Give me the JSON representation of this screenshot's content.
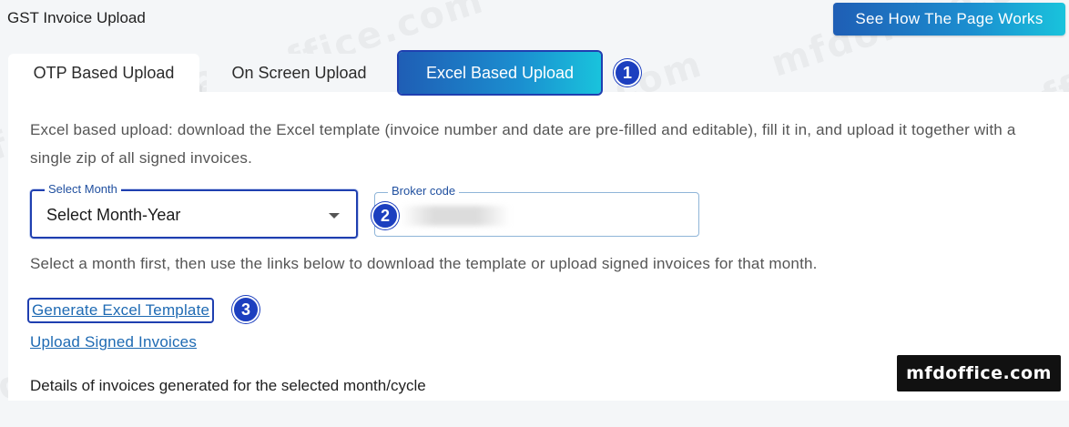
{
  "header": {
    "title": "GST Invoice Upload",
    "help_button": "See How The Page Works"
  },
  "tabs": [
    {
      "label": "OTP Based Upload",
      "active": false
    },
    {
      "label": "On Screen Upload",
      "active": false
    },
    {
      "label": "Excel Based Upload",
      "active": true
    }
  ],
  "callouts": [
    "1",
    "2",
    "3"
  ],
  "description": "Excel based upload: download the Excel template (invoice number and date are pre-filled and editable), fill it in, and upload it together with a single zip of all signed invoices.",
  "form": {
    "month_label": "Select Month",
    "month_value": "Select Month-Year",
    "broker_label": "Broker code",
    "broker_value": ""
  },
  "hint": "Select a month first, then use the links below to download the template or upload signed invoices for that month.",
  "links": {
    "generate": "Generate Excel Template",
    "upload": "Upload Signed Invoices"
  },
  "section_title": "Details of invoices generated for the selected month/cycle",
  "watermark": "mfdoffice.com",
  "colors": {
    "accent_start": "#1f5eb5",
    "accent_end": "#19c3dc",
    "highlight_border": "#1f3fb0",
    "badge": "#1c3fbf",
    "link": "#1e6ab3"
  }
}
